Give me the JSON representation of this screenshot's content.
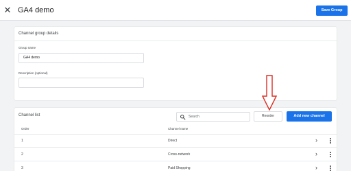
{
  "header": {
    "title": "GA4 demo",
    "save_label": "Save Group",
    "close_icon": "close-icon"
  },
  "details": {
    "heading": "Channel group details",
    "group_name_label": "Group name",
    "group_name_value": "GA4 demo",
    "description_label": "Description (optional)",
    "description_value": ""
  },
  "channel_list": {
    "heading": "Channel list",
    "search_placeholder": "Search",
    "reorder_label": "Reorder",
    "add_label": "Add new channel",
    "columns": {
      "order": "Order",
      "channel": "Channel name"
    },
    "rows": [
      {
        "order": "1",
        "name": "Direct"
      },
      {
        "order": "2",
        "name": "Cross-network"
      },
      {
        "order": "3",
        "name": "Paid Shopping"
      }
    ]
  },
  "colors": {
    "primary": "#1a73e8",
    "annotation_arrow": "#d93025",
    "page_background": "#f1f3f4"
  }
}
